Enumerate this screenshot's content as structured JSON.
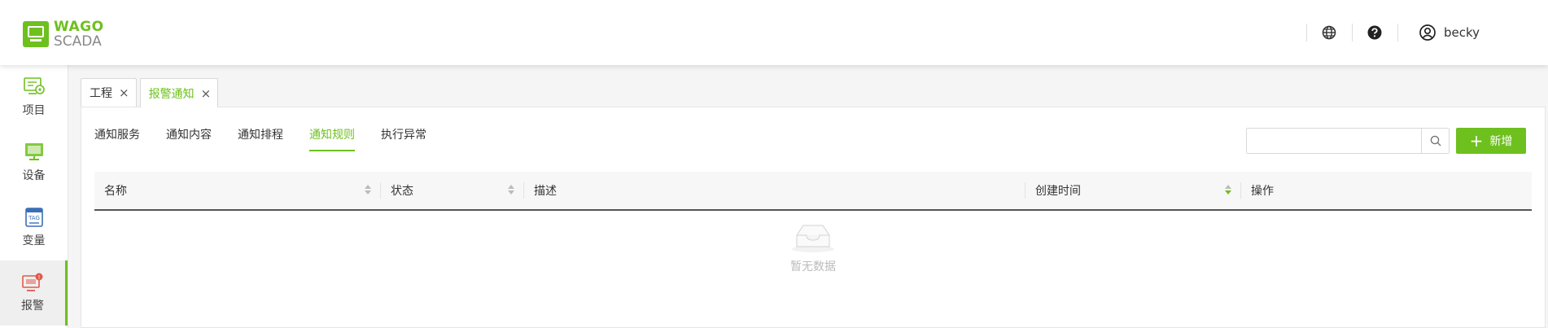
{
  "header": {
    "logo_top": "WAGO",
    "logo_bottom": "SCADA",
    "user_name": "becky",
    "icons": [
      "globe-icon",
      "help-icon",
      "user-icon"
    ],
    "accent_color": "#6ec01e"
  },
  "sidebar": {
    "items": [
      {
        "label": "项目",
        "icon": "project-icon"
      },
      {
        "label": "设备",
        "icon": "device-icon"
      },
      {
        "label": "变量",
        "icon": "tag-icon"
      },
      {
        "label": "报警",
        "icon": "alarm-icon",
        "active": true
      }
    ]
  },
  "tabs": [
    {
      "label": "工程"
    },
    {
      "label": "报警通知",
      "active": true
    }
  ],
  "subnav": {
    "items": [
      "通知服务",
      "通知内容",
      "通知排程",
      "通知规则",
      "执行异常"
    ],
    "active": "通知规则"
  },
  "search": {
    "value": "",
    "placeholder": ""
  },
  "add_button": {
    "label": "新增"
  },
  "table": {
    "columns": [
      "名称",
      "状态",
      "描述",
      "创建时间",
      "操作"
    ],
    "rows": [],
    "empty_text": "暂无数据"
  }
}
